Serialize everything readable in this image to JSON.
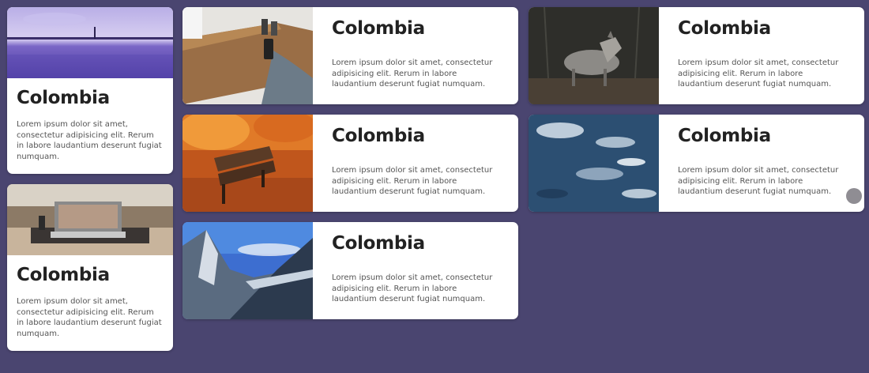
{
  "cards": [
    {
      "id": "lake",
      "title": "Colombia",
      "body": "Lorem ipsum dolor sit amet, consectetur adipisicing elit. Rerum in labore laudantium deserunt fugiat numquam."
    },
    {
      "id": "laptop",
      "title": "Colombia",
      "body": "Lorem ipsum dolor sit amet, consectetur adipisicing elit. Rerum in labore laudantium deserunt fugiat numquam."
    },
    {
      "id": "table",
      "title": "Colombia",
      "body": "Lorem ipsum dolor sit amet, consectetur adipisicing elit. Rerum in labore laudantium deserunt fugiat numquam."
    },
    {
      "id": "bench",
      "title": "Colombia",
      "body": "Lorem ipsum dolor sit amet, consectetur adipisicing elit. Rerum in labore laudantium deserunt fugiat numquam."
    },
    {
      "id": "mountain",
      "title": "Colombia",
      "body": "Lorem ipsum dolor sit amet, consectetur adipisicing elit. Rerum in labore laudantium deserunt fugiat numquam."
    },
    {
      "id": "wolf",
      "title": "Colombia",
      "body": "Lorem ipsum dolor sit amet, consectetur adipisicing elit. Rerum in labore laudantium deserunt fugiat numquam."
    },
    {
      "id": "water",
      "title": "Colombia",
      "body": "Lorem ipsum dolor sit amet, consectetur adipisicing elit. Rerum in labore laudantium deserunt fugiat numquam."
    }
  ],
  "colors": {
    "background": "#4a4570",
    "card": "#ffffff",
    "title": "#222222",
    "body": "#555555"
  }
}
